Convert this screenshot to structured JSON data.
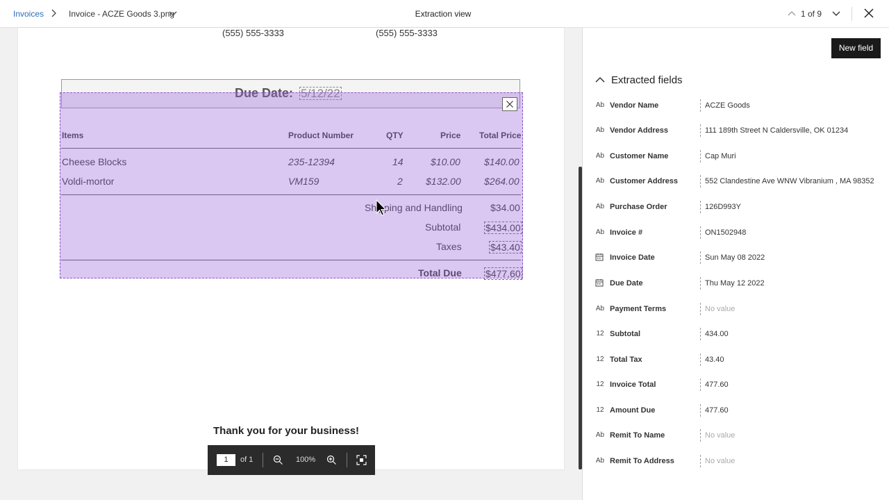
{
  "header": {
    "breadcrumb_root": "Invoices",
    "file_name": "Invoice - ACZE Goods 3.png",
    "title": "Extraction view",
    "doc_counter": "1 of 9"
  },
  "document": {
    "phone_left": "(555) 555-3333",
    "phone_right": "(555) 555-3333",
    "due_label": "Due Date:",
    "due_value": "5/12/22",
    "columns": [
      "Items",
      "Product Number",
      "QTY",
      "Price",
      "Total Price"
    ],
    "rows": [
      {
        "item": "Cheese Blocks",
        "product": "235-12394",
        "qty": "14",
        "price": "$10.00",
        "total": "$140.00"
      },
      {
        "item": "Voldi-mortor",
        "product": "VM159",
        "qty": "2",
        "price": "$132.00",
        "total": "$264.00"
      }
    ],
    "shipping_label": "Shipping and Handling",
    "shipping_value": "$34.00",
    "subtotal_label": "Subtotal",
    "subtotal_value": "$434.00",
    "taxes_label": "Taxes",
    "taxes_value": "$43.40",
    "total_label": "Total Due",
    "total_value": "$477.60",
    "thanks": "Thank you for your business!"
  },
  "pager": {
    "page": "1",
    "of": "of 1",
    "zoom": "100%"
  },
  "panel": {
    "new_field_label": "New field",
    "section_title": "Extracted fields",
    "fields": [
      {
        "type": "Ab",
        "name": "Vendor Name",
        "value": "ACZE Goods"
      },
      {
        "type": "Ab",
        "name": "Vendor Address",
        "value": "111 189th Street N Caldersville, OK 01234"
      },
      {
        "type": "Ab",
        "name": "Customer Name",
        "value": "Cap Muri"
      },
      {
        "type": "Ab",
        "name": "Customer Address",
        "value": "552 Clandestine Ave WNW Vibranium , MA 98352"
      },
      {
        "type": "Ab",
        "name": "Purchase Order",
        "value": "126D993Y"
      },
      {
        "type": "Ab",
        "name": "Invoice #",
        "value": "ON1502948"
      },
      {
        "type": "calendar-icon",
        "name": "Invoice Date",
        "value": "Sun May 08 2022"
      },
      {
        "type": "calendar-icon",
        "name": "Due Date",
        "value": "Thu May 12 2022"
      },
      {
        "type": "Ab",
        "name": "Payment Terms",
        "value": "No value"
      },
      {
        "type": "12",
        "name": "Subtotal",
        "value": "434.00"
      },
      {
        "type": "12",
        "name": "Total Tax",
        "value": "43.40"
      },
      {
        "type": "12",
        "name": "Invoice Total",
        "value": "477.60"
      },
      {
        "type": "12",
        "name": "Amount Due",
        "value": "477.60"
      },
      {
        "type": "Ab",
        "name": "Remit To Name",
        "value": "No value"
      },
      {
        "type": "Ab",
        "name": "Remit To Address",
        "value": "No value"
      }
    ]
  }
}
